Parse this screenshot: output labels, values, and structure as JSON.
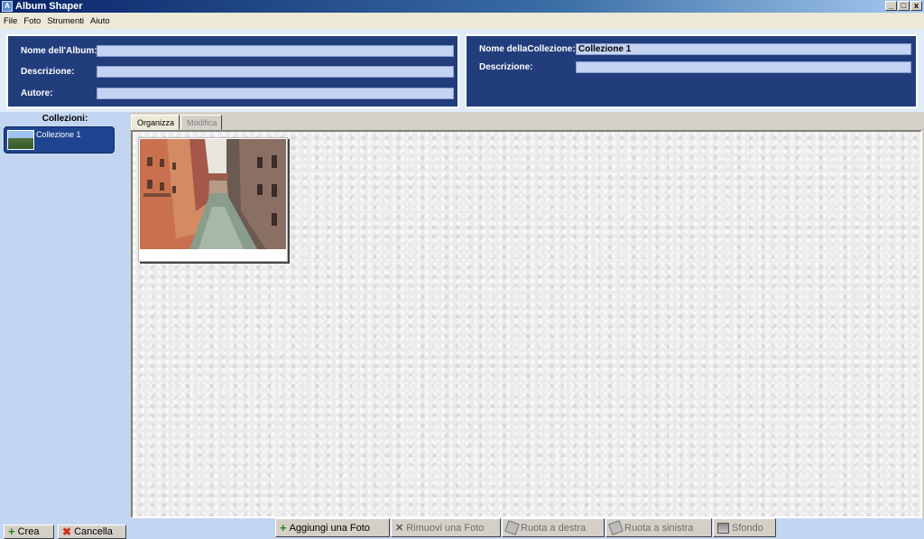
{
  "window": {
    "title": "Album Shaper",
    "controls": [
      "_",
      "□",
      "x"
    ]
  },
  "menu": [
    "File",
    "Foto",
    "Strumenti",
    "Aiuto"
  ],
  "album": {
    "name_label": "Nome dell'Album:",
    "name_value": "",
    "description_label": "Descrizione:",
    "description_value": "",
    "author_label": "Autore:",
    "author_value": ""
  },
  "collection": {
    "name_label": "Nome dellaCollezione:",
    "name_value": "Collezione 1",
    "description_label": "Descrizione:",
    "description_value": ""
  },
  "sidebar": {
    "title": "Collezioni:",
    "items": [
      {
        "label": "Collezione 1"
      }
    ],
    "create_label": "Crea",
    "delete_label": "Cancella"
  },
  "tabs": [
    {
      "label": "Organizza",
      "active": true
    },
    {
      "label": "Modifica",
      "active": false
    }
  ],
  "toolbar": {
    "add_photo": "Aggiungi una Foto",
    "remove_photo": "Rimuovi una Foto",
    "rotate_right": "Ruota a destra",
    "rotate_left": "Ruota a sinistra",
    "background": "Sfondo"
  },
  "colors": {
    "header_panel": "#213d7c",
    "sidebar_bg": "#c3d6f1",
    "selected_item": "#1f4590"
  }
}
